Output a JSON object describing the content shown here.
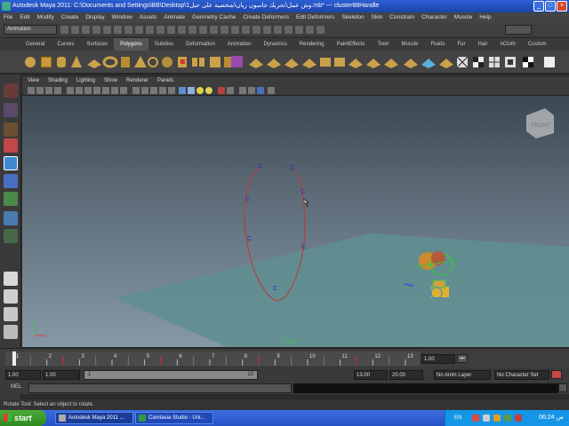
{
  "window": {
    "title": "Autodesk Maya 2011: C:\\Documents and Settings\\BB\\Desktop\\وش عمل\\تحريك جاسون ريان\\شخصية على حبل1.mb*   ---   cluster88Handle"
  },
  "menu": [
    "File",
    "Edit",
    "Modify",
    "Create",
    "Display",
    "Window",
    "Assets",
    "Animate",
    "Geometry Cache",
    "Create Deformers",
    "Edit Deformers",
    "Skeleton",
    "Skin",
    "Constrain",
    "Character",
    "Muscle",
    "Help"
  ],
  "statusline": {
    "mode": "Animation"
  },
  "shelf_tabs": [
    "General",
    "Curves",
    "Surfaces",
    "Polygons",
    "Subdivs",
    "Deformation",
    "Animation",
    "Dynamics",
    "Rendering",
    "PaintEffects",
    "Toon",
    "Muscle",
    "Fluids",
    "Fur",
    "Hair",
    "nCloth",
    "Custom"
  ],
  "shelf_active_tab": "Polygons",
  "panel_menu": [
    "View",
    "Shading",
    "Lighting",
    "Show",
    "Renderer",
    "Panels"
  ],
  "viewport": {
    "view_cube_label": "FRONT",
    "camera_label": "persp",
    "cv_marker": "C"
  },
  "timeslider": {
    "ticks": [
      "1",
      "2",
      "3",
      "4",
      "5",
      "6",
      "7",
      "8",
      "9",
      "10",
      "11",
      "12",
      "13"
    ],
    "current_frame": "1.00"
  },
  "range": {
    "start": "1.00",
    "anim_start": "1.00",
    "range_start_label": "1",
    "range_end_label": "13",
    "anim_end": "13.00",
    "end": "20.00",
    "anim_layer": "No Anim Layer",
    "character_set": "No Character Set"
  },
  "cmdline": {
    "label": "MEL"
  },
  "helpline": {
    "text": "Rotate Tool: Select an object to rotate."
  },
  "taskbar": {
    "start": "start",
    "items": [
      "Autodesk Maya 2011 ...",
      "Camtasia Studio - Unt..."
    ],
    "lang": "EN",
    "clock": "06:24 ص"
  },
  "colors": {
    "accent_blue": "#2d5fd4",
    "curve_red": "#b04040",
    "ground": "#5f8f90"
  },
  "icons": {
    "select_tool": "arrow-icon",
    "lasso": "lasso-icon",
    "move": "move-icon",
    "rotate": "rotate-icon",
    "scale": "scale-icon"
  }
}
